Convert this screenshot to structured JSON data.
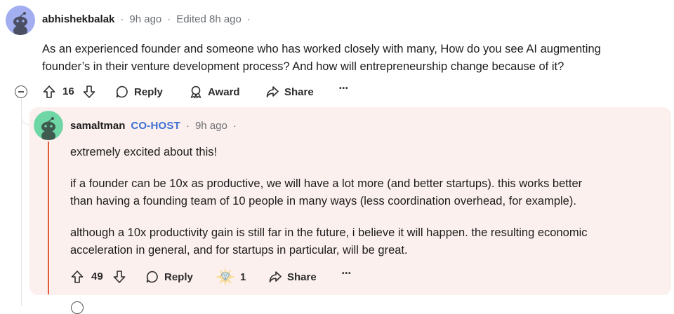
{
  "parent": {
    "username": "abhishekbalak",
    "time": "9h ago",
    "edited": "Edited 8h ago",
    "body_line1": "As an experienced founder and someone who has worked closely with many, How do you see AI augmenting",
    "body_line2": "founder’s in their venture development process? And how will entrepreneurship change because of it?",
    "votes": "16",
    "reply_label": "Reply",
    "award_label": "Award",
    "share_label": "Share",
    "more_label": "•••"
  },
  "reply": {
    "username": "samaltman",
    "badge": "CO-HOST",
    "time": "9h ago",
    "p1": "extremely excited about this!",
    "p2_line1": "if a founder can be 10x as productive, we will have a lot more (and better startups). this works better",
    "p2_line2": "than having a founding team of 10 people in many ways (less coordination overhead, for example).",
    "p3_line1": "although a 10x productivity gain is still far in the future, i believe it will happen. the resulting economic",
    "p3_line2": "acceleration in general, and for startups in particular, will be great.",
    "votes": "49",
    "reply_label": "Reply",
    "award_count": "1",
    "share_label": "Share",
    "more_label": "•••"
  },
  "colors": {
    "accent_red": "#e35a3a",
    "cohost_blue": "#3b6fd4",
    "card_bg": "#fcf0ee"
  },
  "icons": [
    "snoo-avatar-icon",
    "collapse-icon",
    "upvote-icon",
    "downvote-icon",
    "comment-icon",
    "award-icon",
    "share-icon",
    "diamond-award-icon",
    "more-icon"
  ]
}
